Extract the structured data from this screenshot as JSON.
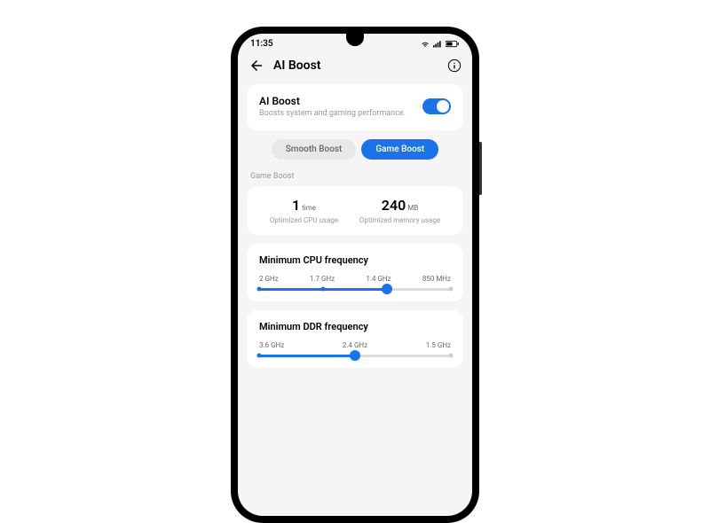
{
  "status": {
    "time": "11:35"
  },
  "header": {
    "title": "AI Boost"
  },
  "aiBoost": {
    "title": "AI Boost",
    "description": "Boosts system and gaming performance.",
    "enabled": true
  },
  "segments": {
    "smooth": "Smooth Boost",
    "game": "Game Boost",
    "active": "game"
  },
  "sectionLabel": "Game Boost",
  "stats": {
    "cpu": {
      "value": "1",
      "unit": "time",
      "label": "Optimized CPU usage"
    },
    "memory": {
      "value": "240",
      "unit": "MB",
      "label": "Optimized memory usage"
    }
  },
  "cpuFreq": {
    "title": "Minimum CPU frequency",
    "labels": [
      "2 GHz",
      "1.7 GHz",
      "1.4 GHz",
      "850 MHz"
    ],
    "selectedIndex": 2
  },
  "ddrFreq": {
    "title": "Minimum DDR frequency",
    "labels": [
      "3.6 GHz",
      "2.4 GHz",
      "1.5 GHz"
    ],
    "selectedIndex": 1
  }
}
